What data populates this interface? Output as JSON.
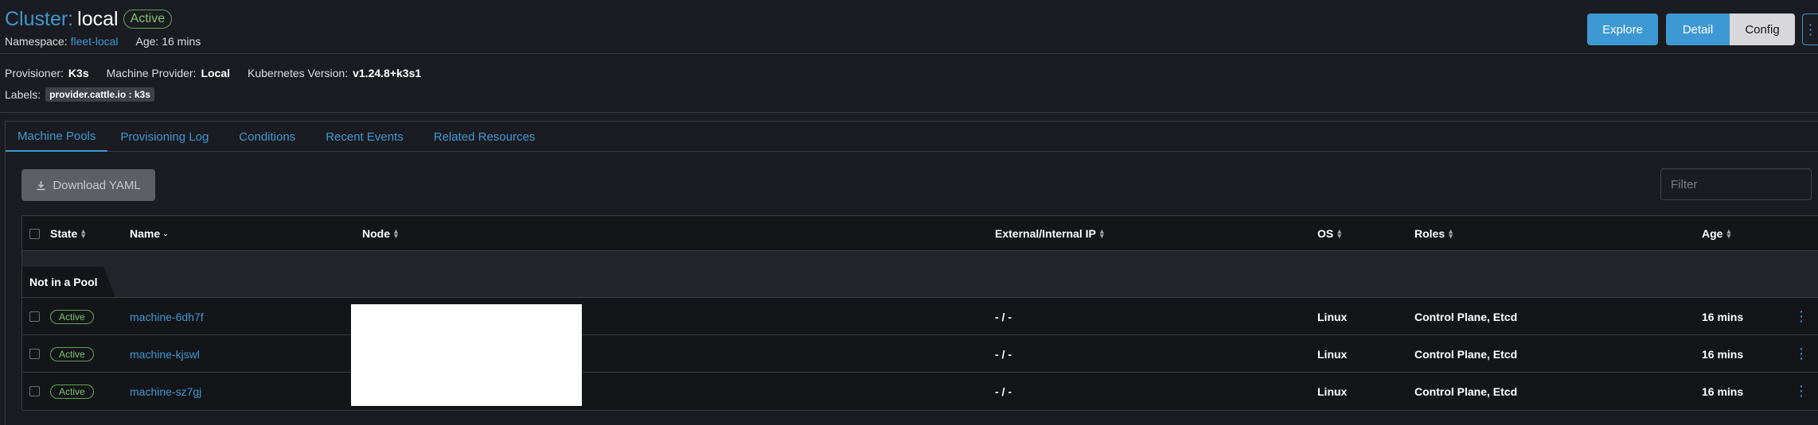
{
  "header": {
    "title_prefix": "Cluster:",
    "title_name": "local",
    "status": "Active",
    "namespace_label": "Namespace:",
    "namespace_value": "fleet-local",
    "age_text": "Age: 16 mins"
  },
  "actions": {
    "explore": "Explore",
    "detail": "Detail",
    "config": "Config",
    "more": "⋮"
  },
  "meta": {
    "provisioner_label": "Provisioner:",
    "provisioner_value": "K3s",
    "machine_provider_label": "Machine Provider:",
    "machine_provider_value": "Local",
    "k8s_version_label": "Kubernetes Version:",
    "k8s_version_value": "v1.24.8+k3s1",
    "labels_label": "Labels:",
    "label_tag": "provider.cattle.io : k3s"
  },
  "tabs": [
    "Machine Pools",
    "Provisioning Log",
    "Conditions",
    "Recent Events",
    "Related Resources"
  ],
  "toolbar": {
    "download": "Download YAML",
    "filter_placeholder": "Filter"
  },
  "table": {
    "headers": {
      "state": "State",
      "name": "Name",
      "node": "Node",
      "ip": "External/Internal IP",
      "os": "OS",
      "roles": "Roles",
      "age": "Age"
    },
    "group": "Not in a Pool",
    "rows": [
      {
        "state": "Active",
        "name": "machine-6dh7f",
        "ip": "- / -",
        "os": "Linux",
        "roles": "Control Plane, Etcd",
        "age": "16 mins"
      },
      {
        "state": "Active",
        "name": "machine-kjswl",
        "ip": "- / -",
        "os": "Linux",
        "roles": "Control Plane, Etcd",
        "age": "16 mins"
      },
      {
        "state": "Active",
        "name": "machine-sz7gj",
        "ip": "- / -",
        "os": "Linux",
        "roles": "Control Plane, Etcd",
        "age": "16 mins"
      }
    ]
  },
  "colors": {
    "accent": "#3d98d3",
    "active_status": "#7fc36f",
    "background": "#1b1c21"
  }
}
